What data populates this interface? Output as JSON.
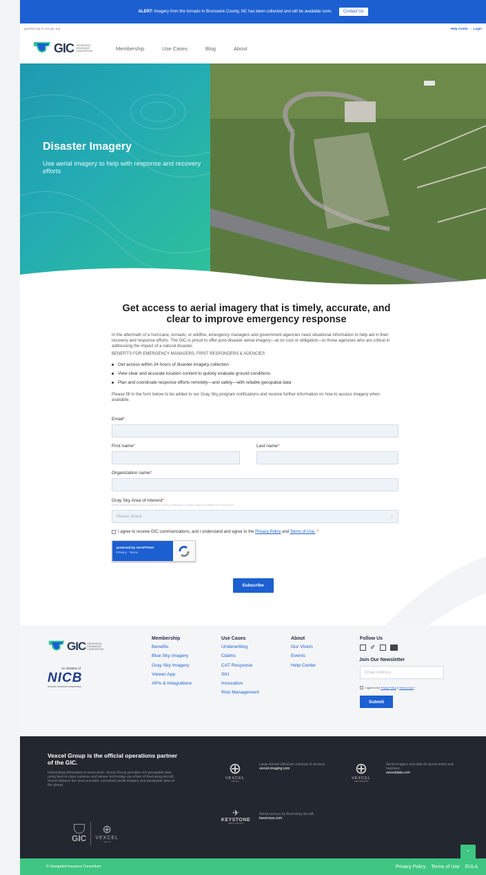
{
  "alert": {
    "prefix": "ALERT:",
    "text": "Imagery from the tornado in Brunswick County, NC has been collected and will be available soon.",
    "button": "Contact Us"
  },
  "topbar": {
    "left": "geointel.org is now gic.org",
    "help": "Help Center",
    "sep": "|",
    "login": "Login"
  },
  "logo": {
    "word": "GIC",
    "sub": "GEOSPATIAL INSURANCE CONSORTIUM"
  },
  "nav": [
    "Membership",
    "Use Cases",
    "Blog",
    "About"
  ],
  "hero": {
    "title": "Disaster Imagery",
    "subtitle": "Use aerial imagery to help with response and recovery efforts"
  },
  "main": {
    "heading": "Get access to aerial imagery that is timely, accurate, and clear to improve emergency response",
    "intro": "In the aftermath of a hurricane, tornado, or wildfire, emergency managers and government agencies need situational information to help aid in their recovery and response efforts. The GIC is proud to offer post-disaster aerial imagery—at no cost or obligation—to those agencies who are critical in addressing the impact of a natural disaster.",
    "caps": "BENEFITS FOR EMERGENCY MANAGERS, FIRST RESPONDERS & AGENCIES",
    "benefits": [
      "Get access within 24 hours of disaster imagery collection",
      "View clear and accurate location content to quickly evaluate ground conditions",
      "Plan and coordinate response efforts remotely—and safely—with reliable geospatial data"
    ],
    "please": "Please fill in the form below to be added to our Gray Sky program notifications and receive further information on how to access imagery when available."
  },
  "form": {
    "email": "Email",
    "first": "First name",
    "last": "Last name",
    "org": "Organization name",
    "area": "Gray Sky Area of Interest",
    "area_help": "Please select the area from you would like to receive notifications. A custom option is available for a broad area.",
    "select_placeholder": "Please Select",
    "consent_pre": "I agree to receive GIC communications, and I understand and agree to the",
    "privacy": "Privacy Policy",
    "and": "and",
    "terms": "Terms of Use.",
    "star": "*",
    "captcha_line1": "protected by reCAPTCHA",
    "captcha_line2": "Privacy · Terms",
    "submit": "Subscribe"
  },
  "footer": {
    "initiative": "An initiative of",
    "nicb": "NICB",
    "nicb_sub": "NATIONAL INSURANCE CRIME BUREAU",
    "cols": [
      {
        "title": "Membership",
        "links": [
          "Benefits",
          "Blue Sky Imagery",
          "Gray Sky Imagery",
          "Viewer App",
          "APIs & Integrations"
        ]
      },
      {
        "title": "Use Cases",
        "links": [
          "Underwriting",
          "Claims",
          "CAT Response",
          "SIU",
          "Innovation",
          "Risk Management"
        ]
      },
      {
        "title": "About",
        "links": [
          "Our Vision",
          "Events",
          "Help Center"
        ]
      }
    ],
    "follow": "Follow Us",
    "newsletter": "Join Our Newsletter",
    "email_placeholder": "Email Address",
    "agree_pre": "I agree to the",
    "agree_privacy": "Privacy Policy",
    "agree_and": "&",
    "agree_terms": "Terms of Use",
    "agree_star": "*",
    "submit": "Submit"
  },
  "partner": {
    "title": "Vexcel Group is the official operations partner of the GIC.",
    "desc": "Unleashing information in every pixel. Vexcel Group provides rich geospatial data using best-in-class cameras and sensor technology via a fleet of fixed-wing aircraft. Vexcel delivers the most accurate, consistent aerial imagery and geospatial data on the planet.",
    "gic": "GIC",
    "vexcel_group": "VEXCEL",
    "group": "GROUP",
    "imaging_name": "VEXCEL",
    "imaging_sub": "IMAGING",
    "imaging_desc": "Large-format UltraCam cameras & sensors.",
    "imaging_url": "vexcel-imaging.com",
    "data_name": "VEXCEL",
    "data_sub": "DATA PROGRAM",
    "data_desc": "Aerial imagery and data for government and business.",
    "data_url": "vexceldata.com",
    "keystone": "KEYSTONE",
    "keystone_sub": "AERIAL SURVEYS",
    "keystone_desc": "Aerial surveys by fixed-wing aircraft.",
    "keystone_url": "kasurveys.com"
  },
  "bottom": {
    "copy": "© Geospatial Insurance Consortium",
    "links": [
      "Privacy Policy",
      "Terms of Use",
      "EULA"
    ]
  },
  "colors": {
    "brand_blue": "#1c5fd1",
    "green": "#3ec682",
    "dark": "#23272f"
  }
}
